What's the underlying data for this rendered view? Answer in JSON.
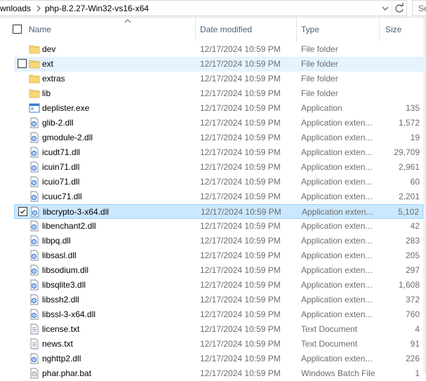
{
  "address": {
    "crumb_partial": "wnloads",
    "crumb_current": "php-8.2.27-Win32-vs16-x64",
    "search_placeholder": "Se"
  },
  "columns": {
    "name": "Name",
    "date": "Date modified",
    "type": "Type",
    "size": "Size"
  },
  "rows": [
    {
      "name": "dev",
      "date": "12/17/2024 10:59 PM",
      "type": "File folder",
      "size": "",
      "icon": "folder-icon"
    },
    {
      "name": "ext",
      "date": "12/17/2024 10:59 PM",
      "type": "File folder",
      "size": "",
      "icon": "folder-icon",
      "state": "hover"
    },
    {
      "name": "extras",
      "date": "12/17/2024 10:59 PM",
      "type": "File folder",
      "size": "",
      "icon": "folder-icon"
    },
    {
      "name": "lib",
      "date": "12/17/2024 10:59 PM",
      "type": "File folder",
      "size": "",
      "icon": "folder-icon"
    },
    {
      "name": "deplister.exe",
      "date": "12/17/2024 10:59 PM",
      "type": "Application",
      "size": "135",
      "icon": "exe-icon"
    },
    {
      "name": "glib-2.dll",
      "date": "12/17/2024 10:59 PM",
      "type": "Application exten...",
      "size": "1,572",
      "icon": "dll-icon"
    },
    {
      "name": "gmodule-2.dll",
      "date": "12/17/2024 10:59 PM",
      "type": "Application exten...",
      "size": "19",
      "icon": "dll-icon"
    },
    {
      "name": "icudt71.dll",
      "date": "12/17/2024 10:59 PM",
      "type": "Application exten...",
      "size": "29,709",
      "icon": "dll-icon"
    },
    {
      "name": "icuin71.dll",
      "date": "12/17/2024 10:59 PM",
      "type": "Application exten...",
      "size": "2,961",
      "icon": "dll-icon"
    },
    {
      "name": "icuio71.dll",
      "date": "12/17/2024 10:59 PM",
      "type": "Application exten...",
      "size": "60",
      "icon": "dll-icon"
    },
    {
      "name": "icuuc71.dll",
      "date": "12/17/2024 10:59 PM",
      "type": "Application exten...",
      "size": "2,201",
      "icon": "dll-icon"
    },
    {
      "name": "libcrypto-3-x64.dll",
      "date": "12/17/2024 10:59 PM",
      "type": "Application exten...",
      "size": "5,102",
      "icon": "dll-icon",
      "state": "selected"
    },
    {
      "name": "libenchant2.dll",
      "date": "12/17/2024 10:59 PM",
      "type": "Application exten...",
      "size": "42",
      "icon": "dll-icon"
    },
    {
      "name": "libpq.dll",
      "date": "12/17/2024 10:59 PM",
      "type": "Application exten...",
      "size": "283",
      "icon": "dll-icon"
    },
    {
      "name": "libsasl.dll",
      "date": "12/17/2024 10:59 PM",
      "type": "Application exten...",
      "size": "205",
      "icon": "dll-icon"
    },
    {
      "name": "libsodium.dll",
      "date": "12/17/2024 10:59 PM",
      "type": "Application exten...",
      "size": "297",
      "icon": "dll-icon"
    },
    {
      "name": "libsqlite3.dll",
      "date": "12/17/2024 10:59 PM",
      "type": "Application exten...",
      "size": "1,608",
      "icon": "dll-icon"
    },
    {
      "name": "libssh2.dll",
      "date": "12/17/2024 10:59 PM",
      "type": "Application exten...",
      "size": "372",
      "icon": "dll-icon"
    },
    {
      "name": "libssl-3-x64.dll",
      "date": "12/17/2024 10:59 PM",
      "type": "Application exten...",
      "size": "760",
      "icon": "dll-icon"
    },
    {
      "name": "license.txt",
      "date": "12/17/2024 10:59 PM",
      "type": "Text Document",
      "size": "4",
      "icon": "text-file-icon"
    },
    {
      "name": "news.txt",
      "date": "12/17/2024 10:59 PM",
      "type": "Text Document",
      "size": "91",
      "icon": "text-file-icon"
    },
    {
      "name": "nghttp2.dll",
      "date": "12/17/2024 10:59 PM",
      "type": "Application exten...",
      "size": "226",
      "icon": "dll-icon"
    },
    {
      "name": "phar.phar.bat",
      "date": "12/17/2024 10:59 PM",
      "type": "Windows Batch File",
      "size": "1",
      "icon": "batch-file-icon"
    }
  ]
}
